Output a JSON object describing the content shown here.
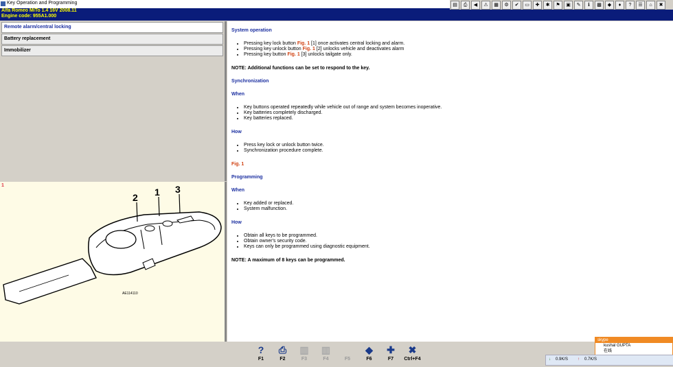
{
  "window": {
    "title": "Key Operation and Programming"
  },
  "header": {
    "line1": "Alfa Romeo   MiTo  1.4 16V 2008.11",
    "line2": "Engine code: 955A1.000"
  },
  "toolbar_icons": [
    "pdf-icon",
    "print-icon",
    "back-icon",
    "warning-icon",
    "book-icon",
    "gear-icon",
    "check-icon",
    "card-icon",
    "tools-icon",
    "bug-icon",
    "flag-icon",
    "doc-icon",
    "wrench-icon",
    "info-icon",
    "grid-icon",
    "car-icon",
    "plug-icon",
    "help-icon",
    "list-icon",
    "home-icon",
    "exit-icon"
  ],
  "left_menu": [
    {
      "label": "Remote alarm/central locking",
      "selected": true
    },
    {
      "label": "Battery replacement",
      "selected": false
    },
    {
      "label": "Immobilizer",
      "selected": false
    }
  ],
  "figure": {
    "number": "1",
    "callouts": [
      "2",
      "1",
      "3"
    ],
    "code": "AE114110"
  },
  "content": {
    "system_operation": {
      "heading": "System operation",
      "items": [
        {
          "pre": "Pressing key lock button ",
          "fig": "Fig. 1",
          "post": " [1] once activates central locking and alarm."
        },
        {
          "pre": "Pressing key unlock button ",
          "fig": "Fig. 1",
          "post": " [2] unlocks vehicle and deactivates alarm"
        },
        {
          "pre": "Pressing key button ",
          "fig": "Fig. 1",
          "post": " [3] unlocks tailgate only."
        }
      ],
      "note": "NOTE: Additional functions can be set to respond to the key."
    },
    "synchronization": {
      "heading": "Synchronization",
      "when_heading": "When",
      "when_items": [
        "Key buttons operated repeatedly while vehicle out of range and system becomes inoperative.",
        "Key batteries completely discharged.",
        "Key batteries replaced."
      ],
      "how_heading": "How",
      "how_items": [
        "Press key lock or unlock button twice.",
        "Synchronization procedure complete."
      ],
      "fig_label": "Fig. 1"
    },
    "programming": {
      "heading": "Programming",
      "when_heading": "When",
      "when_items": [
        "Key added or replaced.",
        "System malfunction."
      ],
      "how_heading": "How",
      "how_items": [
        "Obtain all keys to be programmed.",
        "Obtain owner's security code.",
        "Keys can only be programmed using diagnostic equipment."
      ],
      "note": "NOTE: A maximum of 8 keys can be programmed."
    }
  },
  "fkeys": [
    {
      "label": "F1",
      "icon": "help-icon",
      "enabled": true
    },
    {
      "label": "F2",
      "icon": "print-icon",
      "enabled": true
    },
    {
      "label": "F3",
      "icon": "copy-icon",
      "enabled": false
    },
    {
      "label": "F4",
      "icon": "copy-icon",
      "enabled": false
    },
    {
      "label": "F5",
      "icon": "blank-icon",
      "enabled": false
    },
    {
      "label": "F6",
      "icon": "car-icon",
      "enabled": true
    },
    {
      "label": "F7",
      "icon": "tools-icon",
      "enabled": true
    },
    {
      "label": "Ctrl+F4",
      "icon": "exit-icon",
      "enabled": true
    }
  ],
  "skype": {
    "title": "skype",
    "name": "kushal GUPTA",
    "status": "在线"
  },
  "tray": {
    "down": "0.9K/S",
    "up": "0.7K/S"
  }
}
